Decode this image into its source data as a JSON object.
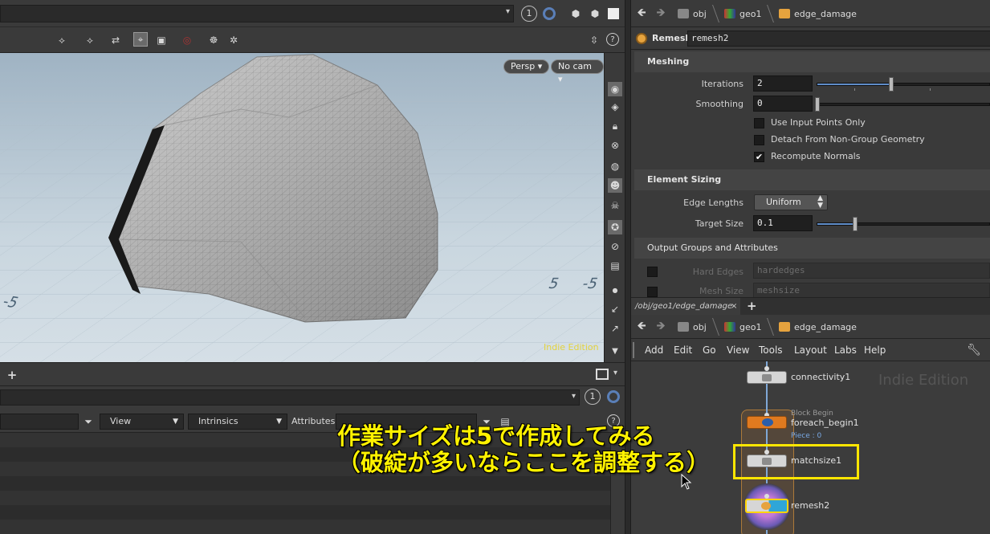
{
  "top_left": {
    "page_number": "1"
  },
  "viewport": {
    "camera_view": "Persp",
    "camera": "No cam",
    "watermark": "Indie Edition",
    "grid_labels": [
      "5",
      "-5",
      "-5"
    ]
  },
  "left_lower": {
    "page_number": "1",
    "filter": {
      "view_label": "View",
      "intrinsics_label": "Intrinsics",
      "attributes_label": "Attributes:"
    }
  },
  "param_path": {
    "crumbs": [
      "obj",
      "geo1",
      "edge_damage"
    ]
  },
  "node_header": {
    "type_label": "Remesh",
    "node_name": "remesh2"
  },
  "params": {
    "meshing": {
      "title": "Meshing",
      "iterations_label": "Iterations",
      "iterations_value": "2",
      "iterations_fraction": 0.43,
      "smoothing_label": "Smoothing",
      "smoothing_value": "0",
      "smoothing_fraction": 0.0,
      "use_input_points": {
        "label": "Use Input Points Only",
        "checked": false
      },
      "detach_non_group": {
        "label": "Detach From Non-Group Geometry",
        "checked": false
      },
      "recompute_normals": {
        "label": "Recompute Normals",
        "checked": true
      }
    },
    "element_sizing": {
      "title": "Element Sizing",
      "edge_lengths_label": "Edge Lengths",
      "edge_lengths_value": "Uniform",
      "target_size_label": "Target Size",
      "target_size_value": "0.1",
      "target_size_fraction": 0.22
    },
    "output": {
      "title": "Output Groups and Attributes",
      "hard_edges_label": "Hard Edges",
      "hard_edges_value": "hardedges",
      "mesh_size_label": "Mesh Size",
      "mesh_size_value": "meshsize"
    }
  },
  "network_tab": {
    "label": "/obj/geo1/edge_damage",
    "close": "×",
    "add": "+"
  },
  "network_path": {
    "crumbs": [
      "obj",
      "geo1",
      "edge_damage"
    ]
  },
  "network_menu": [
    "Add",
    "Edit",
    "Go",
    "View",
    "Tools",
    "Layout",
    "Labs",
    "Help"
  ],
  "network": {
    "watermark": "Indie Edition",
    "nodes": {
      "connectivity": "connectivity1",
      "foreach_caption": "Block Begin",
      "foreach": "foreach_begin1",
      "foreach_piece": "Piece : 0",
      "matchsize": "matchsize1",
      "remesh": "remesh2"
    }
  },
  "annotation": {
    "line1": "作業サイズは5で作成してみる",
    "line2": "（破綻が多いならここを調整する）",
    "color": "#fff200"
  }
}
